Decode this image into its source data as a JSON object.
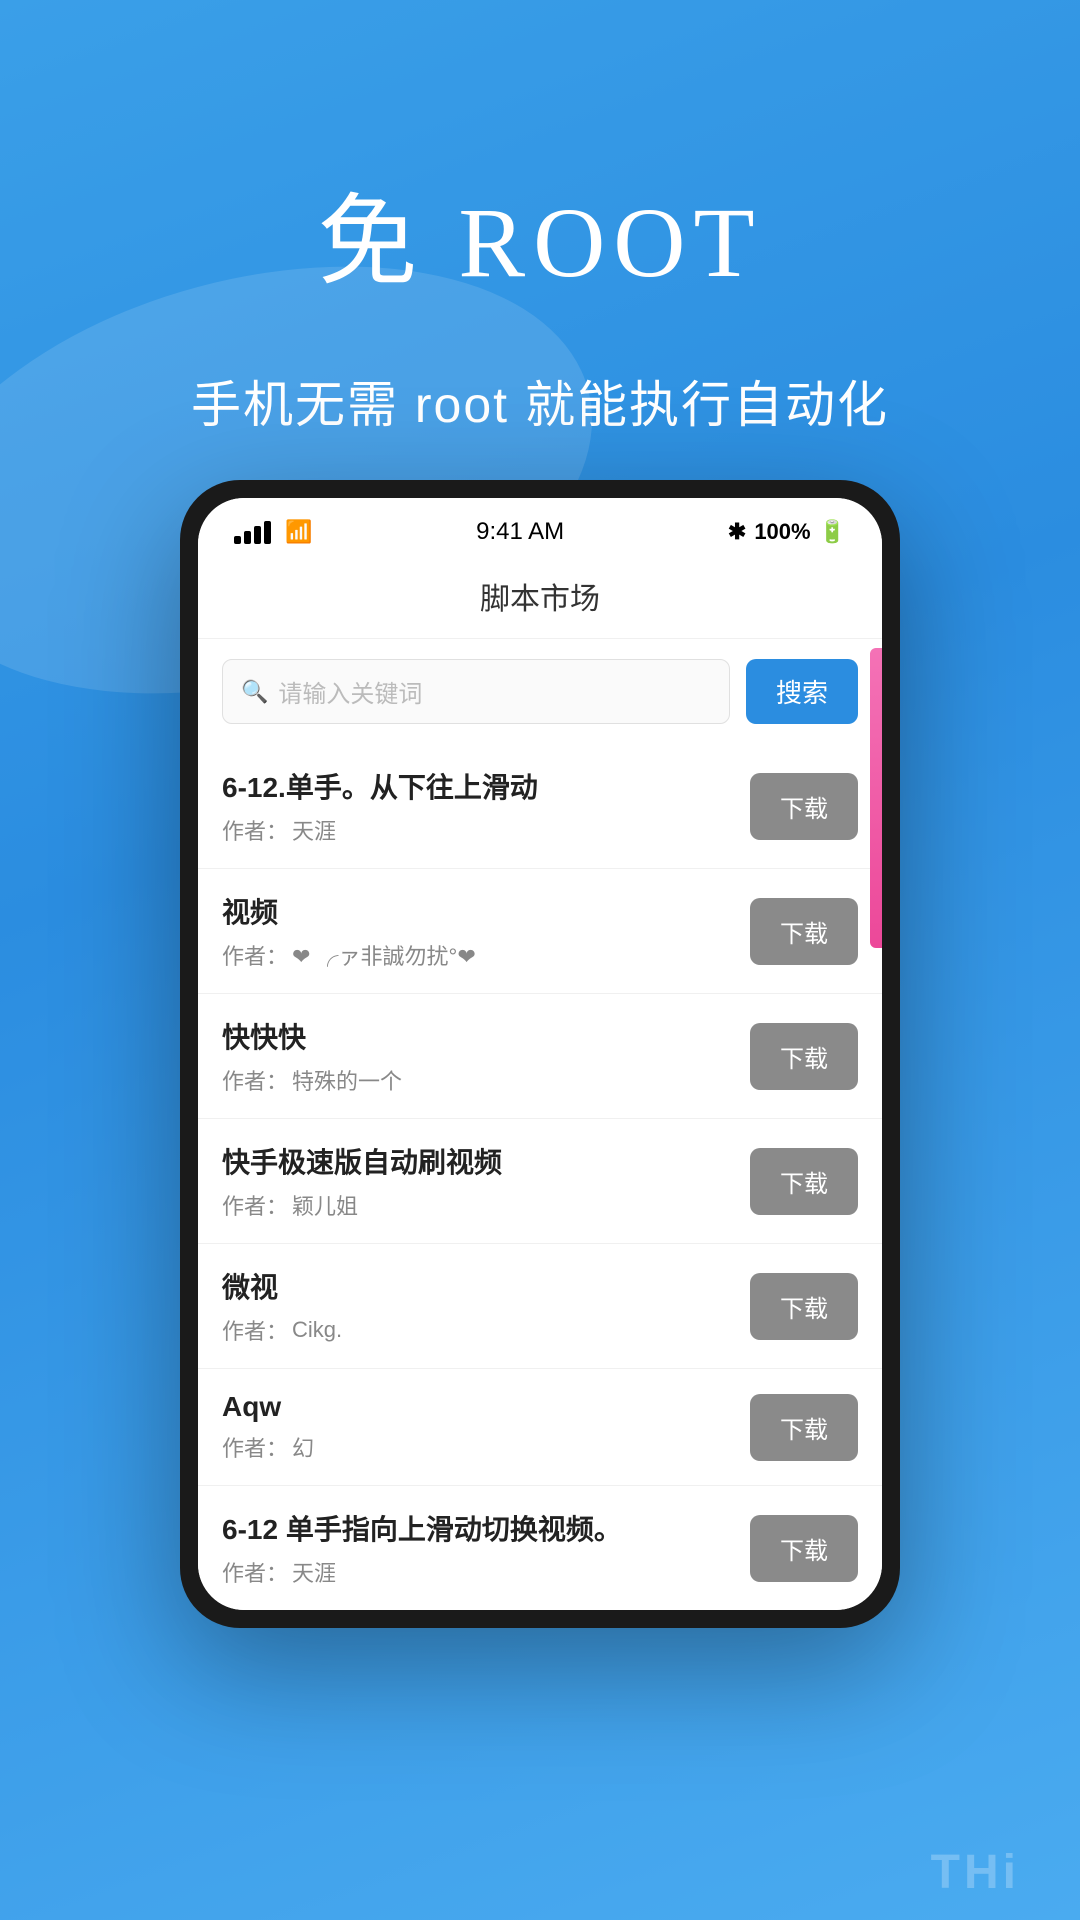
{
  "hero": {
    "title": "免 ROOT",
    "subtitle": "手机无需 root 就能执行自动化"
  },
  "phone": {
    "status_bar": {
      "time": "9:41 AM",
      "bluetooth": "✱",
      "battery": "100%"
    },
    "app_header": "脚本市场",
    "search": {
      "placeholder": "请输入关键词",
      "button_label": "搜索"
    },
    "items": [
      {
        "title": "6-12.单手。从下往上滑动",
        "author_prefix": "作者：",
        "author": "天涯",
        "download_label": "下载"
      },
      {
        "title": "视频",
        "author_prefix": "作者：",
        "author_has_emoji": true,
        "author_text": "❤ ╭ァ非誠勿扰°❤",
        "download_label": "下载"
      },
      {
        "title": "快快快",
        "author_prefix": "作者：",
        "author": "特殊的一个",
        "download_label": "下载"
      },
      {
        "title": "快手极速版自动刷视频",
        "author_prefix": "作者：",
        "author": "颖儿姐",
        "download_label": "下载"
      },
      {
        "title": "微视",
        "author_prefix": "作者：",
        "author": "Cikg.",
        "download_label": "下载"
      },
      {
        "title": "Aqw",
        "author_prefix": "作者：",
        "author": "幻",
        "download_label": "下载"
      },
      {
        "title": "6-12  单手指向上滑动切换视频。",
        "author_prefix": "作者：",
        "author": "天涯",
        "download_label": "下载",
        "partial": true
      }
    ]
  },
  "bottom_text": "THi"
}
